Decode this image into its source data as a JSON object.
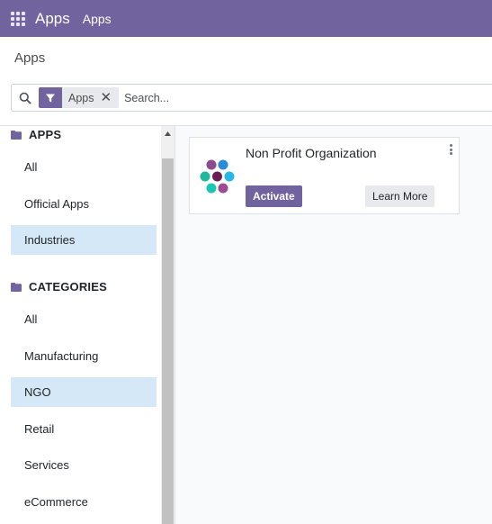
{
  "navbar": {
    "apps_menu_icon": "grid-icon",
    "brand": "Apps",
    "menu_item": "Apps",
    "background": "#71639e"
  },
  "control_panel": {
    "breadcrumb": "Apps",
    "search": {
      "icon": "search-icon",
      "facet": {
        "icon": "filter-icon",
        "label": "Apps",
        "remove": "✕"
      },
      "placeholder": "Search..."
    }
  },
  "sidebar": {
    "apps_section": {
      "icon": "folder-icon",
      "title": "APPS",
      "items": [
        {
          "label": "All",
          "active": false
        },
        {
          "label": "Official Apps",
          "active": false
        },
        {
          "label": "Industries",
          "active": true
        }
      ]
    },
    "categories_section": {
      "icon": "folder-icon",
      "title": "CATEGORIES",
      "items": [
        {
          "label": "All",
          "active": false
        },
        {
          "label": "Manufacturing",
          "active": false
        },
        {
          "label": "NGO",
          "active": true
        },
        {
          "label": "Retail",
          "active": false
        },
        {
          "label": "Services",
          "active": false
        },
        {
          "label": "eCommerce",
          "active": false
        }
      ]
    }
  },
  "cards": [
    {
      "icon": "non-profit-organization-logo-icon",
      "title": "Non Profit Organization",
      "primary_button": "Activate",
      "secondary_button": "Learn More",
      "menu_icon": "vertical-ellipsis-icon"
    }
  ],
  "colors": {
    "primary": "#71639e",
    "active_item": "#d5e8f7",
    "content_bg": "#f9fafb"
  }
}
